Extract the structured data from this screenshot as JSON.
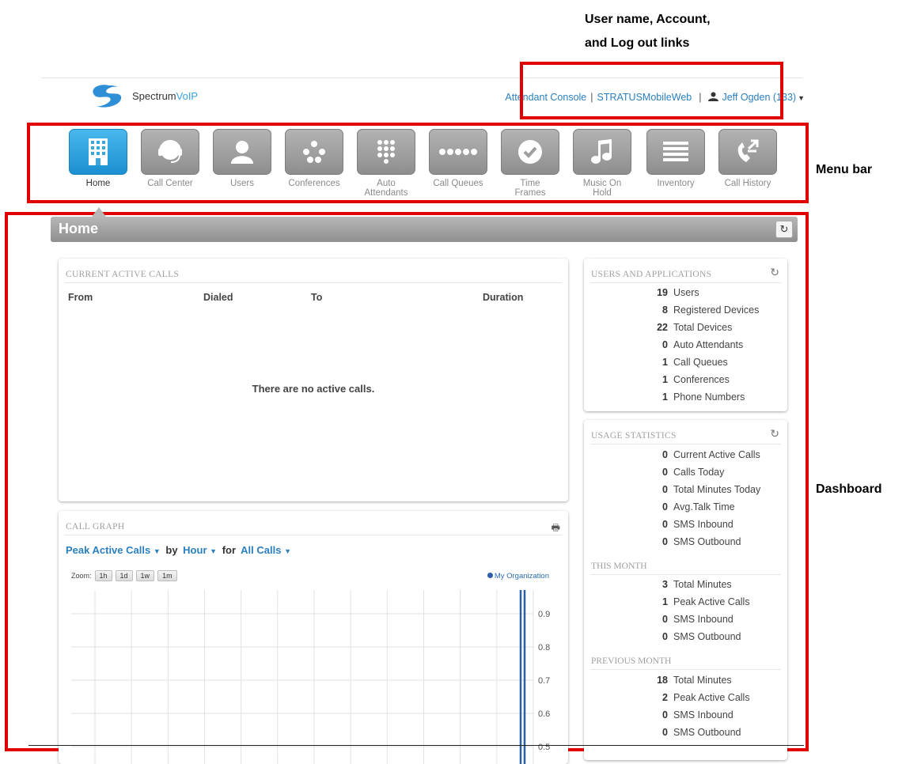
{
  "annotations": {
    "user_links_line1": "User name, Account,",
    "user_links_line2": "and Log out links",
    "menu_bar": "Menu bar",
    "dashboard": "Dashboard"
  },
  "header": {
    "logo_text_main": "Spectrum",
    "logo_text_accent": "VoIP",
    "links": {
      "attendant_console": "Attendant Console",
      "separator": "|",
      "mobile_web": "STRATUSMobileWeb",
      "user": "Jeff Ogden (133)"
    }
  },
  "menu": [
    {
      "label": "Home",
      "icon": "building-icon",
      "active": true
    },
    {
      "label": "Call Center",
      "icon": "headset-icon",
      "active": false
    },
    {
      "label": "Users",
      "icon": "user-icon",
      "active": false
    },
    {
      "label": "Conferences",
      "icon": "conference-icon",
      "active": false
    },
    {
      "label": "Auto\nAttendants",
      "icon": "keypad-icon",
      "active": false
    },
    {
      "label": "Call Queues",
      "icon": "dots-icon",
      "active": false
    },
    {
      "label": "Time\nFrames",
      "icon": "clock-check-icon",
      "active": false
    },
    {
      "label": "Music On\nHold",
      "icon": "music-note-icon",
      "active": false
    },
    {
      "label": "Inventory",
      "icon": "list-icon",
      "active": false
    },
    {
      "label": "Call History",
      "icon": "phone-history-icon",
      "active": false
    }
  ],
  "page": {
    "title": "Home"
  },
  "active_calls": {
    "title": "CURRENT ACTIVE CALLS",
    "columns": [
      "From",
      "Dialed",
      "To",
      "Duration"
    ],
    "empty_message": "There are no active calls."
  },
  "users_apps": {
    "title": "USERS AND APPLICATIONS",
    "items": [
      {
        "n": "19",
        "label": "Users"
      },
      {
        "n": "8",
        "label": "Registered Devices"
      },
      {
        "n": "22",
        "label": "Total Devices"
      },
      {
        "n": "0",
        "label": "Auto Attendants"
      },
      {
        "n": "1",
        "label": "Call Queues"
      },
      {
        "n": "1",
        "label": "Conferences"
      },
      {
        "n": "1",
        "label": "Phone Numbers"
      }
    ]
  },
  "usage": {
    "title": "USAGE STATISTICS",
    "today": [
      {
        "n": "0",
        "label": "Current Active Calls"
      },
      {
        "n": "0",
        "label": "Calls Today"
      },
      {
        "n": "0",
        "label": "Total Minutes Today"
      },
      {
        "n": "0",
        "label": "Avg.Talk Time"
      },
      {
        "n": "0",
        "label": "SMS Inbound"
      },
      {
        "n": "0",
        "label": "SMS Outbound"
      }
    ],
    "this_month_title": "THIS MONTH",
    "this_month": [
      {
        "n": "3",
        "label": "Total Minutes"
      },
      {
        "n": "1",
        "label": "Peak Active Calls"
      },
      {
        "n": "0",
        "label": "SMS Inbound"
      },
      {
        "n": "0",
        "label": "SMS Outbound"
      }
    ],
    "previous_month_title": "PREVIOUS MONTH",
    "previous_month": [
      {
        "n": "18",
        "label": "Total Minutes"
      },
      {
        "n": "2",
        "label": "Peak Active Calls"
      },
      {
        "n": "0",
        "label": "SMS Inbound"
      },
      {
        "n": "0",
        "label": "SMS Outbound"
      }
    ]
  },
  "call_graph": {
    "title": "CALL GRAPH",
    "metric": "Peak Active Calls",
    "by_word": "by",
    "interval": "Hour",
    "for_word": "for",
    "filter": "All Calls",
    "zoom_label": "Zoom:",
    "zoom_buttons": [
      "1h",
      "1d",
      "1w",
      "1m"
    ],
    "legend": "My Organization"
  },
  "chart_data": {
    "type": "line",
    "series": [
      {
        "name": "My Organization"
      }
    ],
    "y_tick_labels": [
      "0.9",
      "0.8",
      "0.7",
      "0.6",
      "0.5"
    ],
    "grid": true,
    "color": "#2d5fa6"
  }
}
